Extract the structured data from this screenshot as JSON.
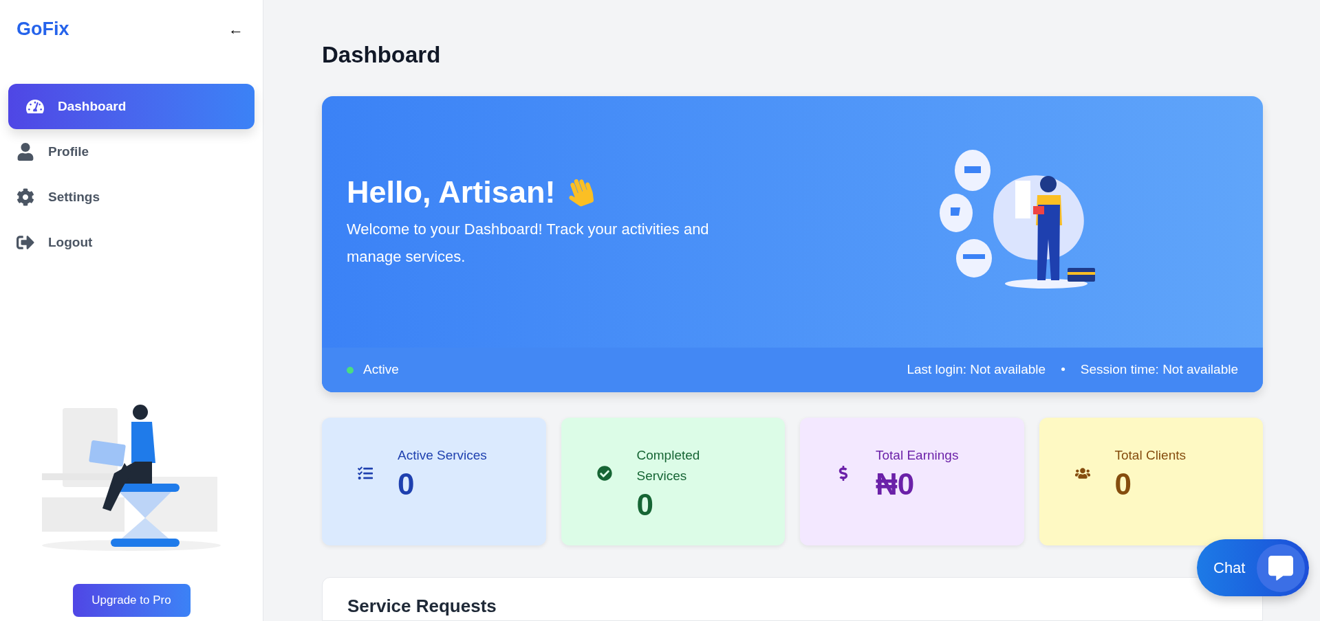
{
  "sidebar": {
    "logo": "GoFix",
    "collapse_glyph": "←",
    "items": [
      {
        "label": "Dashboard",
        "selected": true
      },
      {
        "label": "Profile",
        "selected": false
      },
      {
        "label": "Settings",
        "selected": false
      },
      {
        "label": "Logout",
        "selected": false
      }
    ],
    "upgrade_button": "Upgrade to Pro"
  },
  "page_title": "Dashboard",
  "banner": {
    "greeting": "Hello, Artisan!",
    "message": "Welcome to your Dashboard! Track your activities and manage services.",
    "status": {
      "label": "Active",
      "online": true
    },
    "last_login": "Last login: Not available",
    "separator": "•",
    "session_time": "Session time: Not available"
  },
  "stats": [
    {
      "label": "Active Services",
      "value": "0",
      "color": "#1e40af"
    },
    {
      "label": "Completed Services",
      "value": "0",
      "color": "#166534"
    },
    {
      "label": "Total Earnings",
      "value": "₦0",
      "color": "#6b21a8"
    },
    {
      "label": "Total Clients",
      "value": "0",
      "color": "#854d0e"
    }
  ],
  "service_requests": {
    "title": "Service Requests"
  },
  "chat_button": {
    "label": "Chat"
  }
}
